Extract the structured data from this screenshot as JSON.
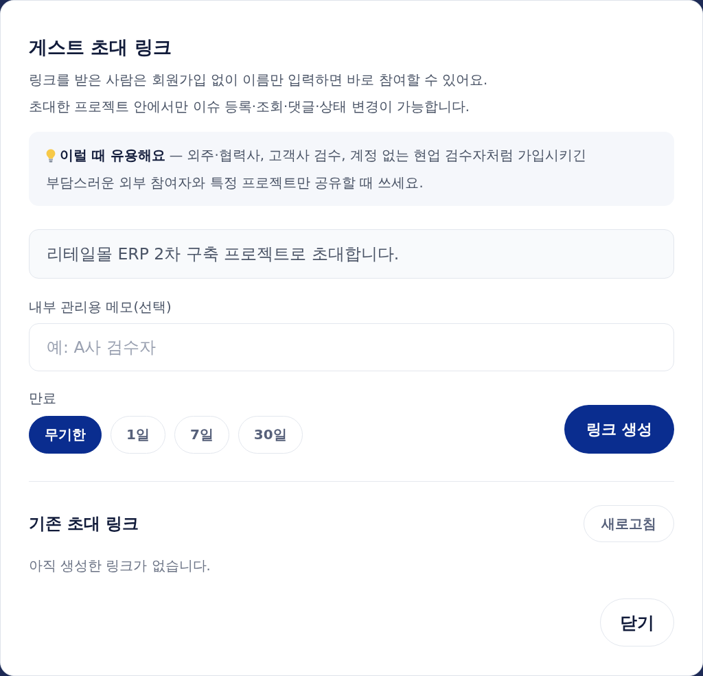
{
  "dialog": {
    "title": "게스트 초대 링크",
    "description": [
      "링크를 받은 사람은 회원가입 없이 이름만 입력하면 바로 참여할 수 있어요.",
      "초대한 프로젝트 안에서만 이슈 등록·조회·댓글·상태 변경이 가능합니다."
    ],
    "tip": {
      "lines": [
        "**이럴 때 유용해요** — 외주·협력사, 고객사 검수, 계정 없는 현업 검수자처럼 가입시키긴",
        "부담스러운 외부 참여자와 특정 프로젝트만 공유할 때 쓰세요."
      ]
    },
    "message_field": {
      "value": "리테일몰 ERP 2차 구축 프로젝트로 초대합니다."
    },
    "memo_field": {
      "label": "내부 관리용 메모(선택)",
      "placeholder": "예: A사 검수자"
    },
    "expiry": {
      "label": "만료",
      "options": [
        {
          "label": "무기한",
          "selected": true
        },
        {
          "label": "1일",
          "selected": false
        },
        {
          "label": "7일",
          "selected": false
        },
        {
          "label": "30일",
          "selected": false
        }
      ]
    },
    "create_button": "링크 생성",
    "existing_links": {
      "title": "기존 초대 링크",
      "refresh_button": "새로고침",
      "empty_text": "아직 생성한 링크가 없습니다."
    },
    "close_button": "닫기"
  }
}
